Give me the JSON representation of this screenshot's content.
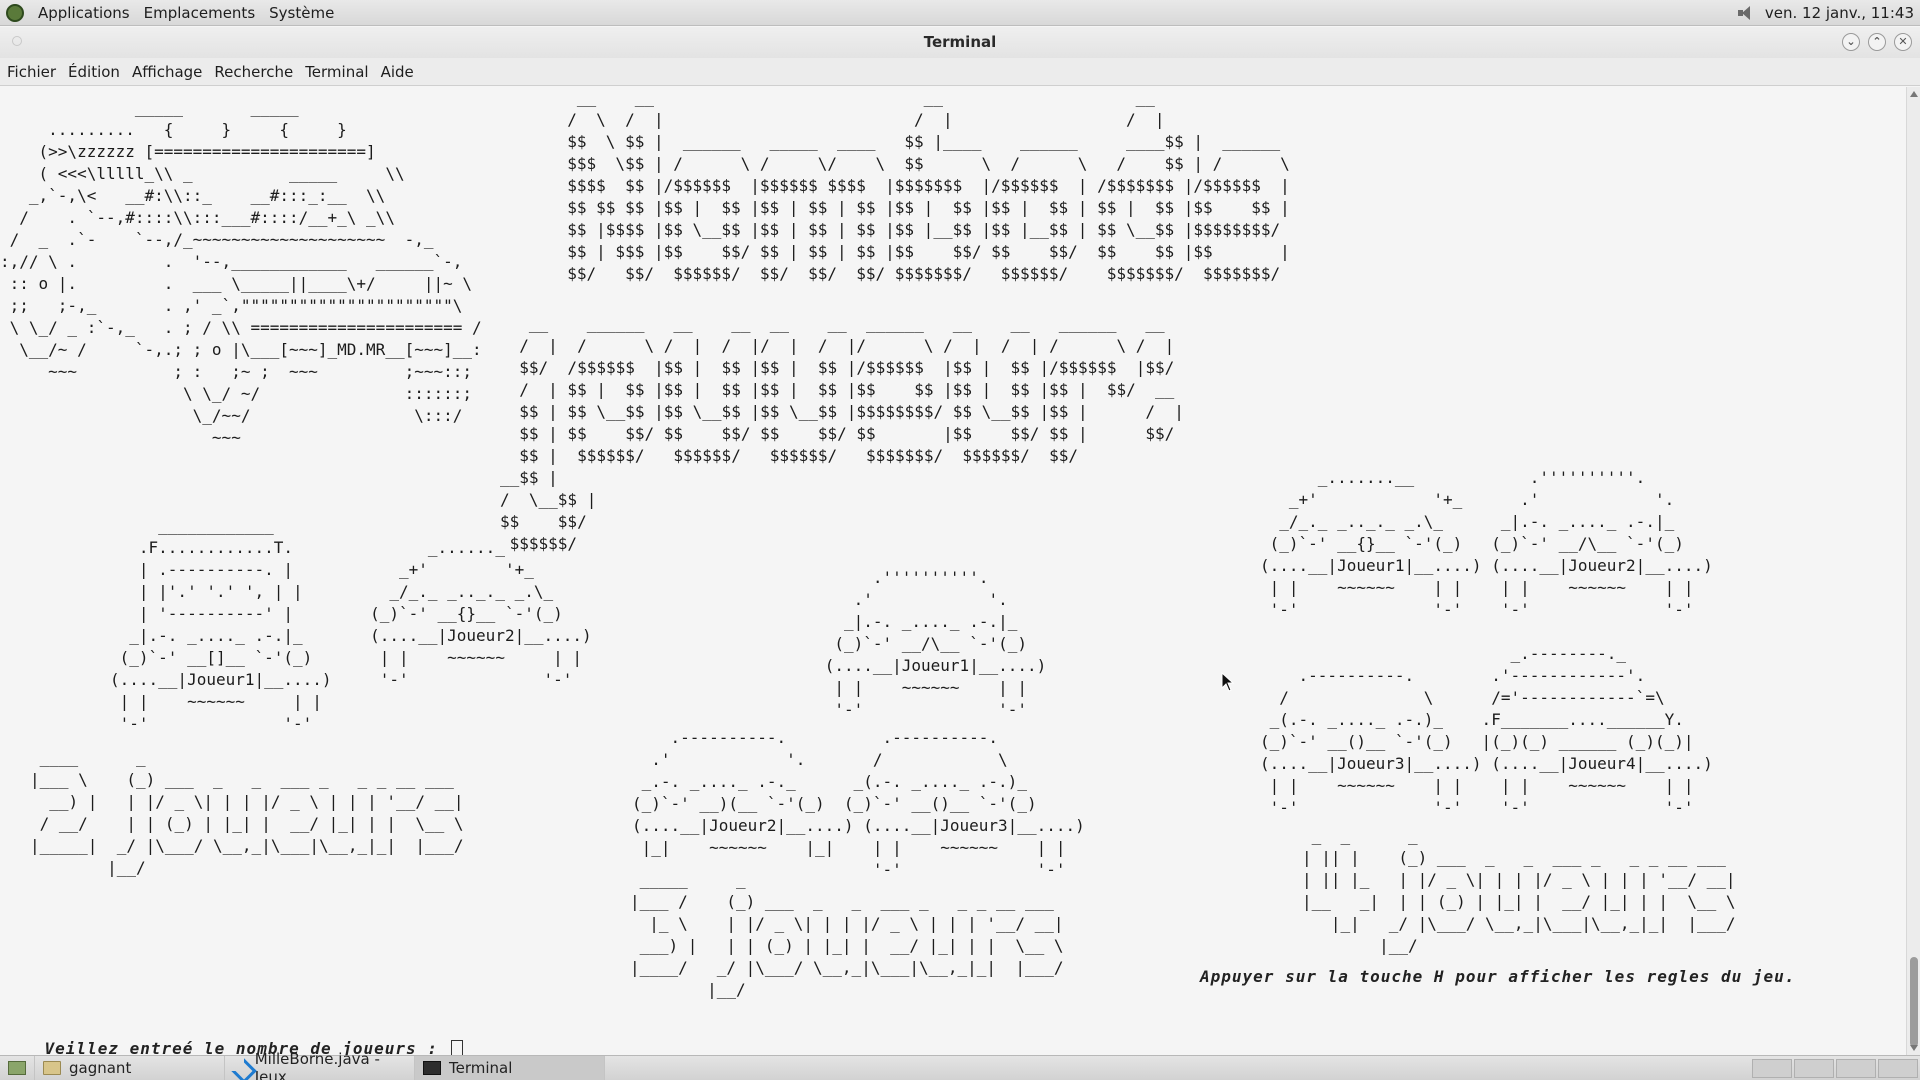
{
  "top_panel": {
    "menus": [
      "Applications",
      "Emplacements",
      "Système"
    ],
    "clock": "ven. 12 janv., 11:43",
    "icons": [
      "app-logo-icon",
      "volume-icon"
    ]
  },
  "window": {
    "title": "Terminal"
  },
  "menubar": {
    "items": [
      "Fichier",
      "Édition",
      "Affichage",
      "Recherche",
      "Terminal",
      "Aide"
    ]
  },
  "terminal": {
    "ascii_racecar": "              _____       _____\n     .........   {     }     {     }\n    (>>\\zzzzzz [======================]\n    ( <<<\\lllll_\\\\ _          _____     \\\\\n   _,`-,\\<   __#:\\\\::_    __#:::_:__  \\\\\n  /    . `--,#::::\\\\:::___#::::/__+_\\ _\\\\\n /  _  .`-    `--,/_~~~~~~~~~~~~~~~~~~~~  -,_\n:,// \\ .         .  '--,____________   ______`-,\n :: o |.         .  ___ \\_____||____\\+/     ||~ \\\n ;;   ;-,_       . ,' _`,\"\"\"\"\"\"\"\"\"\"\"\"\"\"\"\"\"\"\"\"\"\"\\\n \\ \\_/ _ :`-,_   . ; / \\\\ ====================== /\n  \\__/~ /     `-,.; ; o |\\___[~~~]_MD.MR__[~~~]__:\n     ~~~          ; :   ;~ ;  ~~~         ;~~~::;\n                   \\ \\_/ ~/               ::::::;\n                    \\_/~~/                 \\:::/\n                      ~~~",
    "ascii_mille_bornes": "   __    __                            __                    __\n  /  \\  /  |                          /  |                  /  |\n  $$  \\ $$ |  ______   _____  ____   $$ |____    ______     ____$$ |  ______\n  $$$  \\$$ | /      \\ /     \\/    \\  $$      \\  /      \\   /    $$ | /      \\\n  $$$$  $$ |/$$$$$$  |$$$$$$ $$$$  |$$$$$$$  |/$$$$$$  | /$$$$$$$ |/$$$$$$  |\n  $$ $$ $$ |$$ |  $$ |$$ | $$ | $$ |$$ |  $$ |$$ |  $$ | $$ |  $$ |$$    $$ |\n  $$ |$$$$ |$$ \\__$$ |$$ | $$ | $$ |$$ |__$$ |$$ |__$$ | $$ \\__$$ |$$$$$$$$/\n  $$ | $$$ |$$    $$/ $$ | $$ | $$ |$$    $$/ $$    $$/  $$    $$ |$$       |\n  $$/   $$/  $$$$$$/  $$/  $$/  $$/ $$$$$$$/   $$$$$$/    $$$$$$$/  $$$$$$$/",
    "ascii_nouveaux_joueurs": "   __    ______   __    __  __    __  ______   __    __   ______   __\n  /  |  /      \\ /  |  /  |/  |  /  |/      \\ /  |  /  | /      \\ /  |\n  $$/  /$$$$$$  |$$ |  $$ |$$ |  $$ |/$$$$$$  |$$ |  $$ |/$$$$$$  |$$/\n  /  | $$ |  $$ |$$ |  $$ |$$ |  $$ |$$    $$ |$$ |  $$ |$$ |  $$/  __\n  $$ | $$ \\__$$ |$$ \\__$$ |$$ \\__$$ |$$$$$$$$/ $$ \\__$$ |$$ |      /  |\n  $$ | $$    $$/ $$    $$/ $$    $$/ $$       |$$    $$/ $$ |      $$/\n  $$ |  $$$$$$/   $$$$$$/   $$$$$$/   $$$$$$$/  $$$$$$/  $$/\n__$$ |\n/  \\__$$ |\n$$    $$/\n $$$$$$/",
    "ascii_two_players_cars": "     ____________\n   .F............T.              _......_\n   | .----------. |           _+'        '+_\n   | |'.' '.' ', | |         _/_._ _.._._ _.\\_\n   | '----------' |        (_)`-' __{}__ `-'(_)\n  _|.-. _...._ .-.|_       (....__|Joueur2|__....)\n (_)`-' __[]__ `-'(_)       | |    ~~~~~~     | |\n(....__|Joueur1|__....)     '-'              '-'\n | |    ~~~~~~     | |\n '-'              '-'",
    "ascii_three_players": "              .''''''''''.\n            .'            '.\n           _|.-. _...._ .-.|_\n          (_)`-' __/\\__ `-'(_)\n         (....__|Joueur1|__....)\n          | |    ~~~~~~    | |\n          '-'              '-'",
    "ascii_three_players_bottom": "    .----------.          .----------.\n  .'            '.       /            \\\n _.-. _...._ .-._      _(.-. _...._ .-.)_\n(_)`-' __)(__ `-'(_)  (_)`-' __()__ `-'(_)\n(....__|Joueur2|__....) (....__|Joueur3|__....)\n |_|    ~~~~~~    |_|    | |    ~~~~~~    | |\n                         '-'              '-'",
    "ascii_four_players": "      _.......__            .''''''''''.\n   _+'            '+_      .'            '.\n  _/_._ _.._._ _.\\_      _|.-. _...._ .-.|_\n (_)`-' __{}__ `-'(_)   (_)`-' __/\\__ `-'(_)\n(....__|Joueur1|__....) (....__|Joueur2|__....)\n | |    ~~~~~~    | |    | |    ~~~~~~    | |\n '-'              '-'    '-'              '-'\n\n                          _.--------._\n    .----------.        .'------------'.\n  /              \\      /='------------`=\\\n _(.-. _...._ .-.)_    .F_______....______Y.\n(_)`-' __()__ `-'(_)   |(_)(_) ______ (_)(_)|\n(....__|Joueur3|__....) (....__|Joueur4|__....)\n | |    ~~~~~~    | |    | |    ~~~~~~    | |\n '-'              '-'    '-'              '-'",
    "ascii_2_joueurs": " ____      _\n|___ \\    (_) ___  _   _  ___ _   _ _ __ ___\n  __) |   | |/ _ \\| | | |/ _ \\ | | | '__/ __|\n / __/    | | (_) | |_| |  __/ |_| | |  \\__ \\\n|_____|  _/ |\\___/ \\__,_|\\___|\\__,_|_|  |___/\n        |__/",
    "ascii_3_joueurs": " _____     _\n|___ /    (_) ___  _   _  ___ _   _ _ __ ___\n  |_ \\    | |/ _ \\| | | |/ _ \\ | | | '__/ __|\n ___) |   | | (_) | |_| |  __/ |_| | |  \\__ \\\n|____/   _/ |\\___/ \\__,_|\\___|\\__,_|_|  |___/\n        |__/",
    "ascii_4_joueurs": " _  _      _\n| || |    (_) ___  _   _  ___ _   _ _ __ ___\n| || |_   | |/ _ \\| | | |/ _ \\ | | | '__/ __|\n|__   _|  | | (_) | |_| |  __/ |_| | |  \\__ \\\n   |_|   _/ |\\___/ \\__,_|\\___|\\__,_|_|  |___/\n        |__/",
    "help_message": "Appuyer sur la touche H pour afficher les regles du jeu.",
    "prompt": "Veillez entreé le nombre de joueurs : "
  },
  "taskbar": {
    "tasks": [
      {
        "label": "gagnant",
        "icon": "folder-icon"
      },
      {
        "label": "MilleBorne.java - Jeux...",
        "icon": "vscode-icon"
      },
      {
        "label": "Terminal",
        "icon": "terminal-icon"
      }
    ]
  }
}
